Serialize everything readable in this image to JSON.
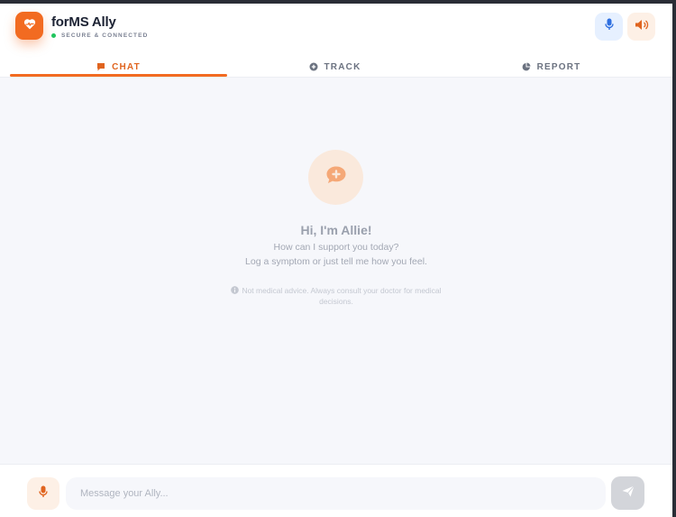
{
  "app": {
    "title": "forMS Ally",
    "status": "SECURE & CONNECTED",
    "icons": {
      "logo": "heart-pulse-icon",
      "mic": "microphone-icon",
      "speaker": "speaker-icon"
    }
  },
  "tabs": [
    {
      "label": "CHAT",
      "icon": "chat-bubble-icon",
      "active": true
    },
    {
      "label": "TRACK",
      "icon": "plus-circle-icon",
      "active": false
    },
    {
      "label": "REPORT",
      "icon": "pie-chart-icon",
      "active": false
    }
  ],
  "empty_state": {
    "icon": "comment-medical-icon",
    "greeting": "Hi, I'm Allie!",
    "line1": "How can I support you today?",
    "line2": "Log a symptom or just tell me how you feel.",
    "disclaimer": "Not medical advice. Always consult your doctor for medical decisions."
  },
  "composer": {
    "placeholder": "Message your Ally...",
    "value": "",
    "send_icon": "paper-plane-icon"
  },
  "colors": {
    "accent": "#f26b21",
    "status_ok": "#22c55e",
    "mic_blue": "#2f6fe0"
  }
}
